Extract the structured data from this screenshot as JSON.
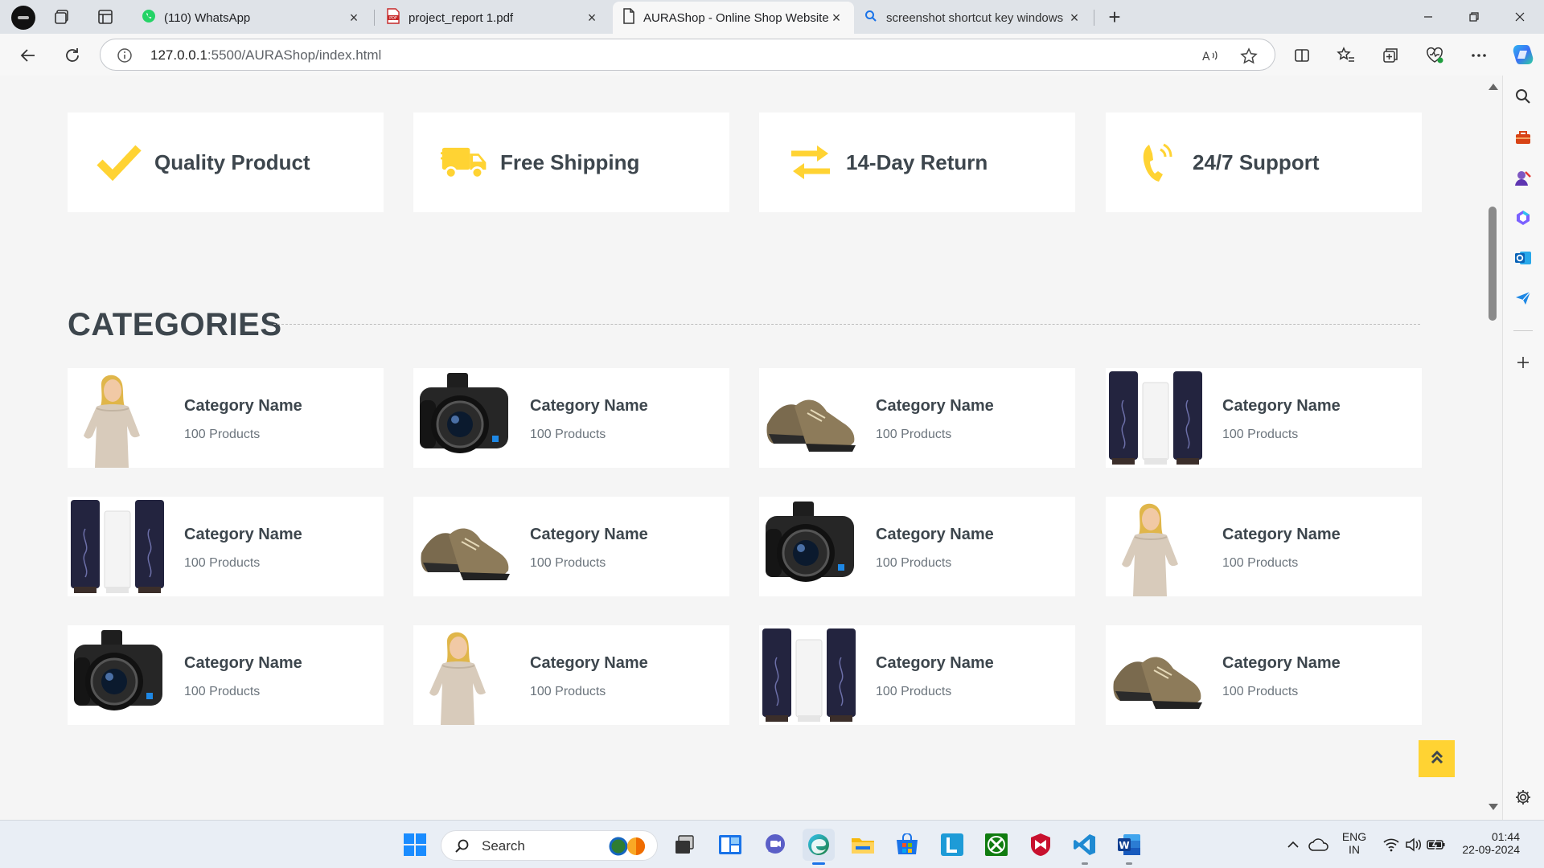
{
  "browser": {
    "tabs": [
      {
        "title": "(110) WhatsApp",
        "icon": "whatsapp-icon"
      },
      {
        "title": "project_report 1.pdf",
        "icon": "pdf-icon"
      },
      {
        "title": "AURAShop - Online Shop Website",
        "icon": "page-icon",
        "active": true
      },
      {
        "title": "screenshot shortcut key windows",
        "icon": "search-icon"
      }
    ],
    "address": {
      "host": "127.0.0.1",
      "path": ":5500/AURAShop/index.html"
    }
  },
  "features": [
    {
      "label": "Quality Product",
      "icon": "check-icon"
    },
    {
      "label": "Free Shipping",
      "icon": "truck-icon"
    },
    {
      "label": "14-Day Return",
      "icon": "exchange-icon"
    },
    {
      "label": "24/7 Support",
      "icon": "phone-volume-icon"
    }
  ],
  "categories": {
    "title": "CATEGORIES",
    "items": [
      {
        "name": "Category Name",
        "count": "100 Products",
        "image": "woman"
      },
      {
        "name": "Category Name",
        "count": "100 Products",
        "image": "camera"
      },
      {
        "name": "Category Name",
        "count": "100 Products",
        "image": "shoes"
      },
      {
        "name": "Category Name",
        "count": "100 Products",
        "image": "cosmetics"
      },
      {
        "name": "Category Name",
        "count": "100 Products",
        "image": "cosmetics"
      },
      {
        "name": "Category Name",
        "count": "100 Products",
        "image": "shoes"
      },
      {
        "name": "Category Name",
        "count": "100 Products",
        "image": "camera"
      },
      {
        "name": "Category Name",
        "count": "100 Products",
        "image": "woman"
      },
      {
        "name": "Category Name",
        "count": "100 Products",
        "image": "camera"
      },
      {
        "name": "Category Name",
        "count": "100 Products",
        "image": "woman"
      },
      {
        "name": "Category Name",
        "count": "100 Products",
        "image": "cosmetics"
      },
      {
        "name": "Category Name",
        "count": "100 Products",
        "image": "shoes"
      }
    ]
  },
  "colors": {
    "accent": "#FFD333",
    "heading": "#3D464D",
    "muted": "#6C757D",
    "page_bg": "#F5F5F5"
  },
  "taskbar": {
    "search_placeholder": "Search",
    "language": "ENG",
    "region": "IN",
    "time": "01:44",
    "date": "22-09-2024"
  }
}
